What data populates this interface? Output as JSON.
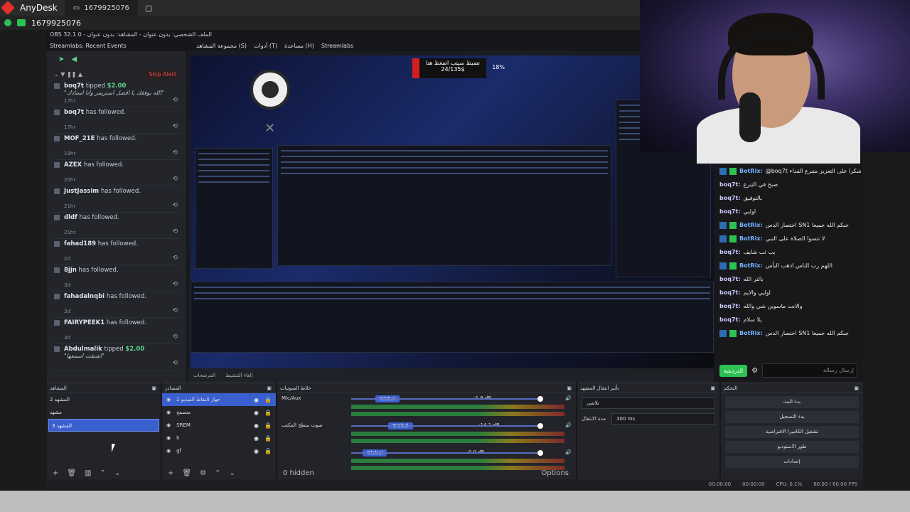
{
  "anydesk": {
    "brand": "AnyDesk",
    "tab_id": "1679925076",
    "connection_id": "1679925076"
  },
  "obs": {
    "title": "OBS 32.1.0 - الملف الشخصي: بدون عنوان - المشاهد: بدون عنوان",
    "menu": [
      "Streamlabs",
      "مساعدة (H)",
      "أدوات (T)",
      "مجموعة المشاهد (S)"
    ],
    "events_title": "Streamlabs: Recent Events",
    "skip_alert": "Skip Alert",
    "events": [
      {
        "user": "boq7t",
        "action": "tipped",
        "amount": "$2.00",
        "message": "\"الله يوفقك يا افضل استريمر وانا استاذك\"",
        "time": "17hr"
      },
      {
        "user": "boq7t",
        "action": "has followed.",
        "amount": "",
        "message": "",
        "time": "17hr"
      },
      {
        "user": "MOF_21E",
        "action": "has followed.",
        "amount": "",
        "message": "",
        "time": "19hr"
      },
      {
        "user": "AZEX",
        "action": "has followed.",
        "amount": "",
        "message": "",
        "time": "20hr"
      },
      {
        "user": "JustJassim",
        "action": "has followed.",
        "amount": "",
        "message": "",
        "time": "21hr"
      },
      {
        "user": "dldf",
        "action": "has followed.",
        "amount": "",
        "message": "",
        "time": "21hr"
      },
      {
        "user": "fahad189",
        "action": "has followed.",
        "amount": "",
        "message": "",
        "time": "2d"
      },
      {
        "user": "8jjn",
        "action": "has followed.",
        "amount": "",
        "message": "",
        "time": "3d"
      },
      {
        "user": "fahadalnqbi",
        "action": "has followed.",
        "amount": "",
        "message": "",
        "time": "3d"
      },
      {
        "user": "FAIRYPEEK1",
        "action": "has followed.",
        "amount": "",
        "message": "",
        "time": "3d"
      },
      {
        "user": "Abdulmalik",
        "action": "tipped",
        "amount": "$2.00",
        "message": "\"اشتقت اسمعها\"",
        "time": ""
      }
    ],
    "goal": {
      "title": "تضبط سيتب اضغط هنا",
      "progress": "24/135$",
      "percent": "18%"
    },
    "preview_buttons": [
      "المرشحات",
      "إلغاء التنشيط"
    ],
    "chat": {
      "lines": [
        {
          "user": "BotRix:",
          "text": "اختصار الدس SN1 جبكم الله جميعا",
          "bot": true
        },
        {
          "user": "BotRix:",
          "text": "@boq7t شكرا على التعزيز متبرع الفداء",
          "bot": true
        },
        {
          "user": "boq7t:",
          "text": "صبح في التبرع",
          "bot": false
        },
        {
          "user": "boq7t:",
          "text": "بالتوفيق",
          "bot": false
        },
        {
          "user": "boq7t:",
          "text": "اوليي",
          "bot": false
        },
        {
          "user": "BotRix:",
          "text": "اختصار الدس SN1 جبكم الله جميعا",
          "bot": true
        },
        {
          "user": "BotRix:",
          "text": "لا تنسوا الصلاة على النبي",
          "bot": true
        },
        {
          "user": "boq7t:",
          "text": "بب ثب شايف",
          "bot": false
        },
        {
          "user": "BotRix:",
          "text": "اللهم رب الناس اذهب البأس",
          "bot": true
        },
        {
          "user": "boq7t:",
          "text": "بالتر الله",
          "bot": false
        },
        {
          "user": "boq7t:",
          "text": "اوليي والايم",
          "bot": false
        },
        {
          "user": "boq7t:",
          "text": "والانت ماسوين شي والله",
          "bot": false
        },
        {
          "user": "boq7t:",
          "text": "يلا سلام",
          "bot": false
        },
        {
          "user": "BotRix:",
          "text": "اختصار الدس SN1 جبكم الله جميعا",
          "bot": true
        }
      ],
      "placeholder": "إرسال رسالة",
      "send": "الدردشة"
    },
    "docks": {
      "scenes_title": "المشاهد",
      "scenes": [
        "المشهد 2",
        "مشهد",
        "المشهد 3"
      ],
      "sources_title": "المصادر",
      "sources": [
        "جهاز التقاط الفيديو 2",
        "متصفح",
        "SREM",
        "h",
        "gf"
      ],
      "mixer_title": "خلاط الصوتيات",
      "mixer": [
        {
          "name": "Mic/Aux",
          "level": "-1.8 dB",
          "badge": "Global"
        },
        {
          "name": "صوت سطح المكتب",
          "level": "-14.1 dB",
          "badge": "Global"
        },
        {
          "name": "",
          "level": "0.0 dB",
          "badge": "Global"
        }
      ],
      "hidden": "0 hidden",
      "options": "Options",
      "transitions_title": "تأثير انتقال المشهد",
      "transition": "تلاشي",
      "duration_label": "مدة الانتقال",
      "duration": "300 ms",
      "controls_title": "التحكم",
      "controls": [
        "بدء البث",
        "بدء التسجيل",
        "تشغيل الكاميرا الافتراضية",
        "طور الاستوديو",
        "إعدادات"
      ]
    },
    "status": {
      "rec": "00:00:00",
      "stream": "00:00:00",
      "cpu": "CPU: 0.1%",
      "fps": "60.00 / 60.00 FPS"
    }
  },
  "colors": {
    "accent": "#3a5fcf",
    "green": "#2cc153",
    "red": "#d41f1f"
  }
}
